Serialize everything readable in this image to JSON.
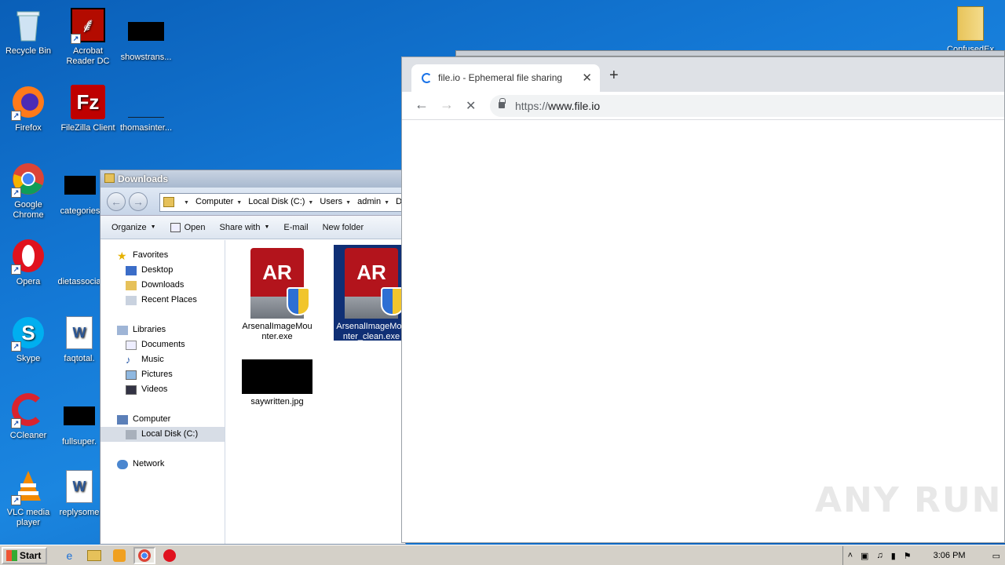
{
  "desktop": {
    "icons": [
      {
        "label": "Recycle Bin"
      },
      {
        "label": "Acrobat Reader DC"
      },
      {
        "label": "showstrans..."
      },
      {
        "label": "Firefox"
      },
      {
        "label": "FileZilla Client"
      },
      {
        "label": "thomasinter..."
      },
      {
        "label": "Google Chrome"
      },
      {
        "label": "categories"
      },
      {
        "label": "Opera"
      },
      {
        "label": "dietassocia"
      },
      {
        "label": "Skype"
      },
      {
        "label": "faqtotal."
      },
      {
        "label": "CCleaner"
      },
      {
        "label": "fullsuper."
      },
      {
        "label": "VLC media player"
      },
      {
        "label": "replysome"
      },
      {
        "label": "ConfusedEx"
      }
    ]
  },
  "explorer": {
    "title": "Downloads",
    "address": [
      "Computer",
      "Local Disk (C:)",
      "Users",
      "admin",
      "Downlo"
    ],
    "toolbar": {
      "organize": "Organize",
      "open": "Open",
      "share": "Share with",
      "email": "E-mail",
      "new_folder": "New folder"
    },
    "nav": {
      "favorites": "Favorites",
      "desktop": "Desktop",
      "downloads": "Downloads",
      "recent": "Recent Places",
      "libraries": "Libraries",
      "documents": "Documents",
      "music": "Music",
      "pictures": "Pictures",
      "videos": "Videos",
      "computer": "Computer",
      "local_disk": "Local Disk (C:)",
      "network": "Network"
    },
    "files": [
      {
        "name": "ArsenalImageMounter.exe"
      },
      {
        "name": "ArsenalImageMounter_clean.exe"
      },
      {
        "name": "saywritten.jpg"
      }
    ]
  },
  "chrome": {
    "tab_title": "file.io - Ephemeral file sharing",
    "url_scheme": "https://",
    "url_host": "www.file.io",
    "accent": "#1a73e8"
  },
  "watermark": "ANY RUN",
  "taskbar": {
    "start": "Start",
    "clock": "3:06 PM"
  }
}
